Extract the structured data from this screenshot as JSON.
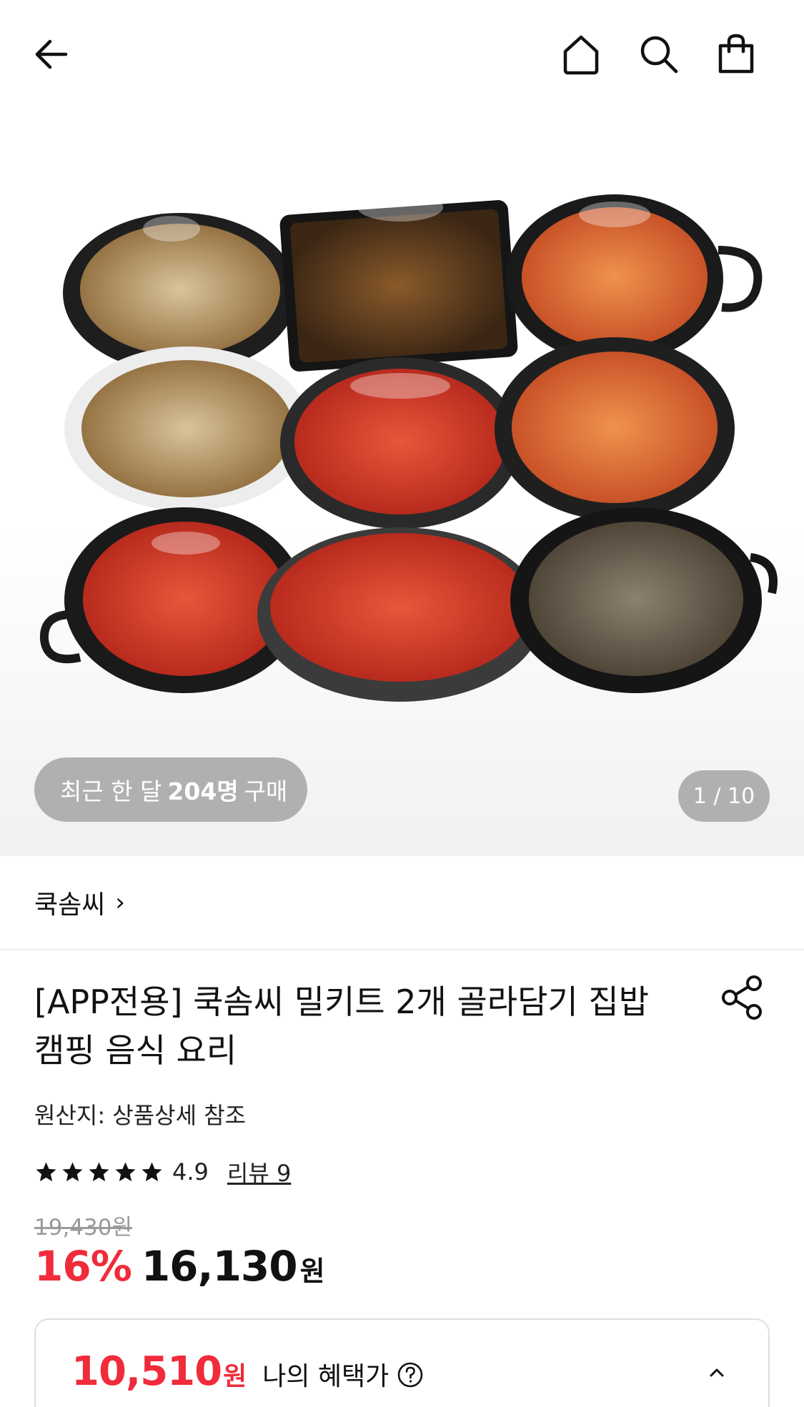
{
  "header": {
    "back_icon": "arrow-left-icon",
    "home_icon": "home-icon",
    "search_icon": "search-icon",
    "cart_icon": "shopping-bag-icon"
  },
  "gallery": {
    "purchase_prefix": "최근 한 달",
    "purchase_count": "204명",
    "purchase_suffix": "구매",
    "page_counter": "1 / 10"
  },
  "brand": {
    "name": "쿡솜씨",
    "chevron": "›"
  },
  "product": {
    "title_line1": "[APP전용] 쿡솜씨 밀키트 2개 골라담기 집밥",
    "title_line2": "캠핑 음식 요리",
    "origin": "원산지: 상품상세 참조",
    "rating": "4.9",
    "star_count": 5,
    "review_link": "리뷰 9",
    "original_price": "19,430원",
    "discount_rate": "16%",
    "sale_price": "16,130",
    "currency": "원"
  },
  "benefit": {
    "price": "10,510",
    "currency": "원",
    "label": "나의 혜택가",
    "help_icon": "question-circle-icon",
    "toggle_icon": "chevron-up-icon"
  },
  "colors": {
    "accent_red": "#f02b3b",
    "text": "#111111",
    "muted": "#9a9a9a"
  }
}
